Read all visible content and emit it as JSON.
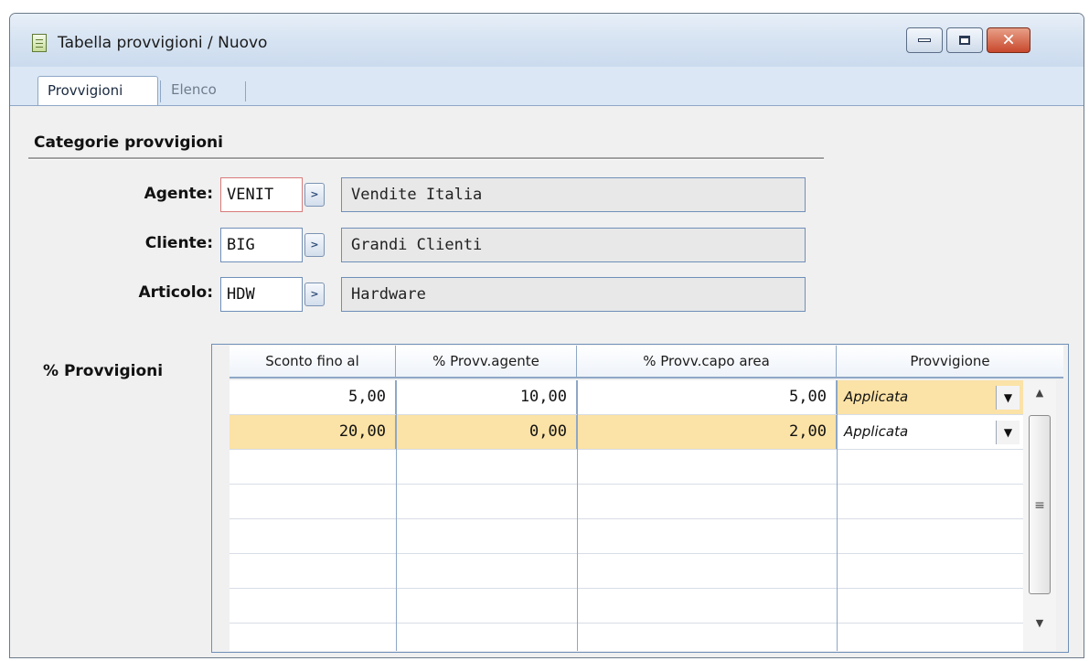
{
  "window": {
    "title": "Tabella provvigioni / Nuovo",
    "controls": {
      "minimize": "minimize",
      "maximize": "maximize",
      "close": "✕"
    }
  },
  "tabs": [
    {
      "label": "Provvigioni",
      "active": true
    },
    {
      "label": "Elenco",
      "active": false
    }
  ],
  "section": {
    "title": "Categorie provvigioni"
  },
  "fields": {
    "agente": {
      "label": "Agente:",
      "code": "VENIT",
      "description": "Vendite Italia"
    },
    "cliente": {
      "label": "Cliente:",
      "code": "BIG",
      "description": "Grandi Clienti"
    },
    "articolo": {
      "label": "Articolo:",
      "code": "HDW",
      "description": "Hardware"
    }
  },
  "grid": {
    "label": "% Provvigioni",
    "columns": [
      "Sconto fino al",
      "% Provv.agente",
      "% Provv.capo area",
      "Provvigione"
    ],
    "rows": [
      {
        "sconto": "5,00",
        "agente": "10,00",
        "capo_area": "5,00",
        "provvigione": "Applicata"
      },
      {
        "sconto": "20,00",
        "agente": "0,00",
        "capo_area": "2,00",
        "provvigione": "Applicata"
      }
    ],
    "selected_row": 1,
    "highlight_color": "#fbe2a6"
  },
  "icons": {
    "app": "table-document-icon",
    "zoom": "link-arrow-icon",
    "dropdown": "chevron-down-icon"
  }
}
